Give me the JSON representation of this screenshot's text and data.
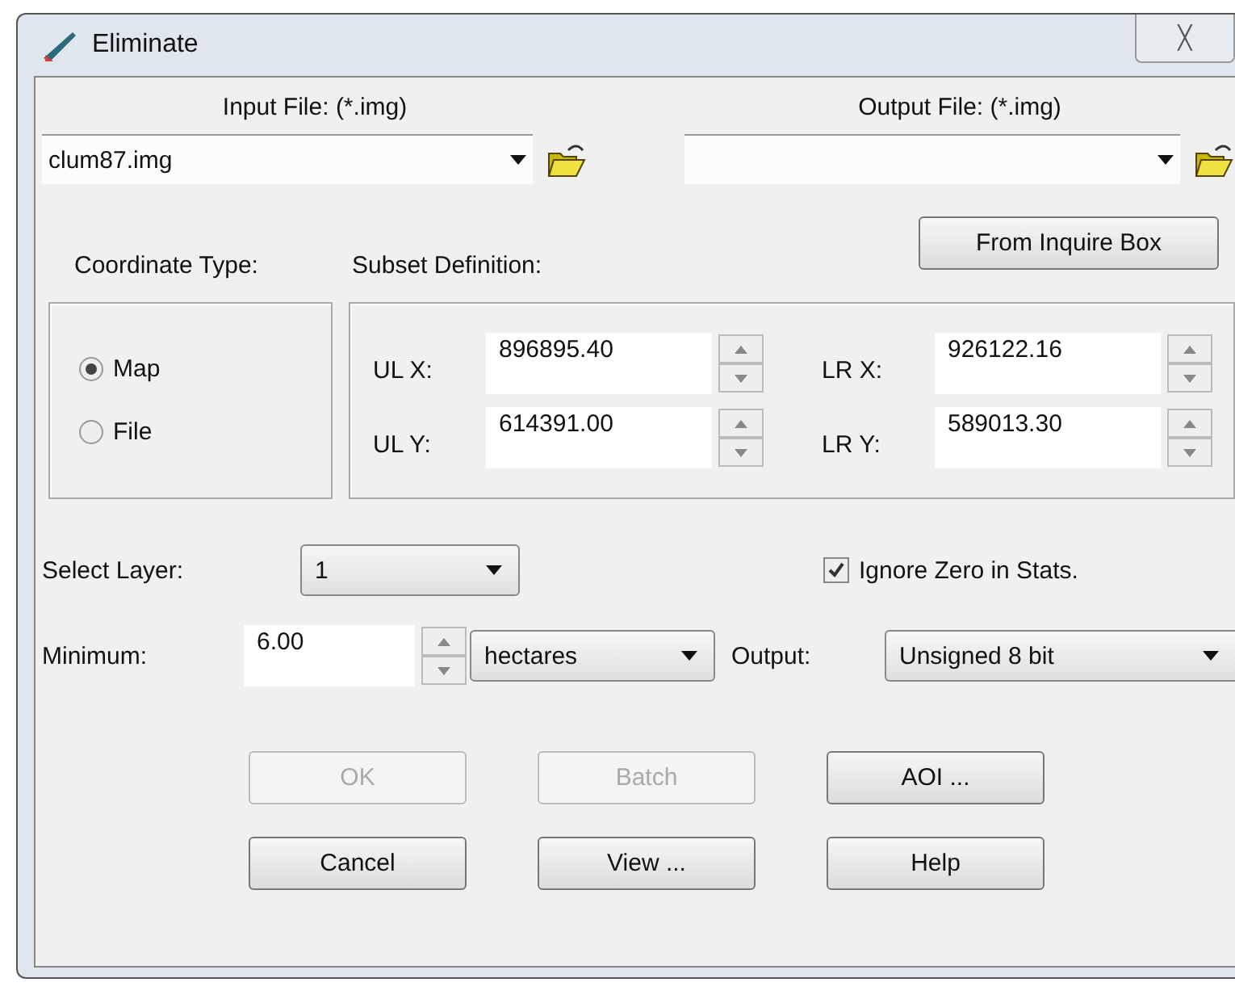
{
  "window": {
    "title": "Eliminate",
    "close": "╳"
  },
  "input_file": {
    "label": "Input File: (*.img)",
    "value": "clum87.img"
  },
  "output_file": {
    "label": "Output File: (*.img)"
  },
  "from_inquire_box": "From Inquire Box",
  "coordinate_type": {
    "label": "Coordinate Type:",
    "options": [
      {
        "label": "Map",
        "selected": true
      },
      {
        "label": "File",
        "selected": false
      }
    ]
  },
  "subset_definition": {
    "label": "Subset Definition:",
    "fields": [
      {
        "label": "UL X:",
        "value": "896895.40"
      },
      {
        "label": "LR X:",
        "value": "926122.16"
      },
      {
        "label": "UL Y:",
        "value": "614391.00"
      },
      {
        "label": "LR Y:",
        "value": "589013.30"
      }
    ]
  },
  "select_layer": {
    "label": "Select Layer:",
    "value": "1"
  },
  "ignore_zero": {
    "label": "Ignore Zero in Stats.",
    "checked": true
  },
  "minimum": {
    "label": "Minimum:",
    "value": "6.00",
    "unit": "hectares"
  },
  "output": {
    "label": "Output:",
    "value": "Unsigned 8 bit"
  },
  "buttons": [
    {
      "label": "OK",
      "disabled": true
    },
    {
      "label": "Batch",
      "disabled": true
    },
    {
      "label": "AOI ...",
      "disabled": false
    },
    {
      "label": "Cancel",
      "disabled": false
    },
    {
      "label": "View ...",
      "disabled": false
    },
    {
      "label": "Help",
      "disabled": false
    }
  ]
}
